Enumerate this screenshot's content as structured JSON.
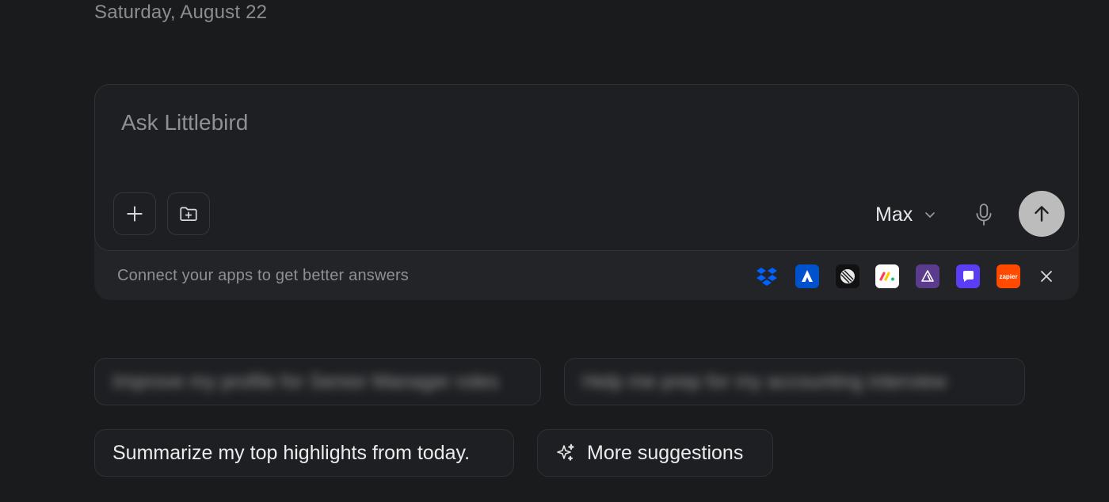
{
  "header": {
    "date": "Saturday, August 22"
  },
  "composer": {
    "placeholder": "Ask Littlebird",
    "model": "Max",
    "icons": {
      "add": "plus-icon",
      "folder": "folder-plus-icon",
      "model_chevron": "chevron-down-icon",
      "mic": "microphone-icon",
      "send": "arrow-up-icon"
    }
  },
  "connect": {
    "text": "Connect your apps to get better answers",
    "apps": [
      {
        "name": "dropbox-icon",
        "color": "#0061fe"
      },
      {
        "name": "atlassian-icon",
        "color": "#0052cc"
      },
      {
        "name": "linear-icon",
        "color": "#111111"
      },
      {
        "name": "monday-icon",
        "color": "#ffffff"
      },
      {
        "name": "attio-icon",
        "color": "#5b3b8c"
      },
      {
        "name": "front-icon",
        "color": "#5b3df5"
      },
      {
        "name": "zapier-icon",
        "color": "#ff4a00",
        "label": "zapier"
      }
    ],
    "close": "close-icon"
  },
  "suggestions": {
    "blurred": [
      "Improve my profile for Senior Manager roles",
      "Help me prep for my accounting interview"
    ],
    "summary": "Summarize my top highlights from today.",
    "more": "More suggestions"
  }
}
